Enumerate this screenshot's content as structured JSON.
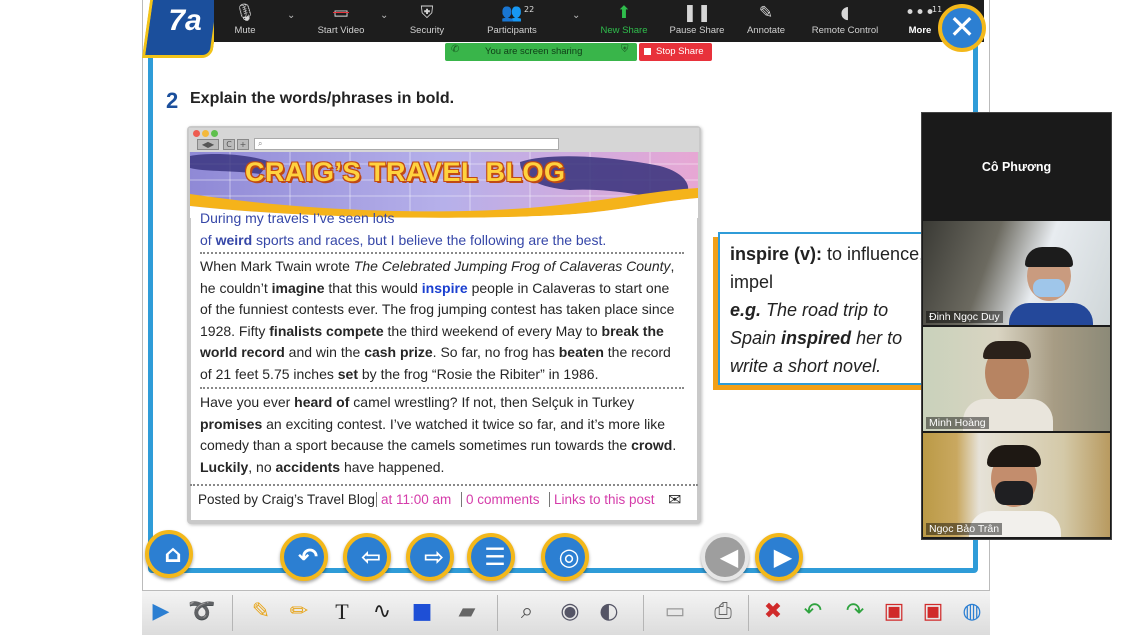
{
  "zoom": {
    "toolbar": [
      {
        "label": "Mute",
        "icon": "microphone-icon"
      },
      {
        "label": "Start Video",
        "icon": "video-off-icon"
      },
      {
        "label": "Security",
        "icon": "shield-icon"
      },
      {
        "label": "Participants",
        "icon": "participants-icon",
        "count": "22"
      },
      {
        "label": "New Share",
        "icon": "share-arrow-icon"
      },
      {
        "label": "Pause Share",
        "icon": "pause-icon"
      },
      {
        "label": "Annotate",
        "icon": "pencil-icon"
      },
      {
        "label": "Remote Control",
        "icon": "mouse-icon"
      },
      {
        "label": "More",
        "icon": "more-dots-icon",
        "count": "11"
      }
    ],
    "sharing_banner": "You are screen sharing",
    "stop_share": "Stop Share",
    "host_name": "Cô Phương",
    "participants": [
      {
        "name": "Đinh Ngọc Duy"
      },
      {
        "name": "Minh Hoàng"
      },
      {
        "name": "Ngọc Bảo Trân"
      }
    ]
  },
  "slide": {
    "unit": "7a",
    "question_number": "2",
    "question": "Explain the words/phrases in bold.",
    "blog": {
      "title": "CRAIG’S TRAVEL BLOG",
      "p1_line1": "During my travels I’ve seen lots",
      "p1_line2_pre": "of ",
      "p1_line2_bold": "weird",
      "p1_line2_post": " sports and races, but I believe the following are the best.",
      "p2": [
        [
          "When Mark Twain wrote ",
          "i:The Celebrated Jumping Frog of Calaveras County",
          ","
        ],
        [
          "he couldn’t ",
          "b:imagine",
          " that this would ",
          "c:inspire",
          " people in Calaveras to start one"
        ],
        [
          "of the funniest contests ever. The frog jumping contest has taken place since"
        ],
        [
          "1928. Fifty ",
          "b:finalists compete",
          " the third weekend of every May to ",
          "b:break the"
        ],
        [
          "b:world record",
          " and win the ",
          "b:cash prize",
          ". So far, no frog has ",
          "b:beaten",
          " the record"
        ],
        [
          "of 21 feet 5.75 inches ",
          "b:set",
          " by the frog “Rosie the Ribiter” in 1986."
        ]
      ],
      "p3": [
        [
          "Have you ever ",
          "b:heard of",
          " camel wrestling? If not, then Selçuk in Turkey"
        ],
        [
          "b:promises",
          " an exciting contest. I’ve watched it twice so far, and it’s more like"
        ],
        [
          "comedy than a sport because the camels sometimes run towards the ",
          "b:crowd",
          "."
        ],
        [
          "b:Luckily",
          ", no ",
          "b:accidents",
          " have happened."
        ]
      ],
      "posted_by": "Posted by Craig’s Travel Blog",
      "time": "at 11:00 am",
      "comments": "0 comments",
      "links": "Links to this post"
    },
    "definition": {
      "term": "inspire (v):",
      "meaning": " to influence, impel",
      "eg_label": "e.g.",
      "eg_pre": " The road trip to Spain ",
      "eg_bold": "inspired",
      "eg_post": " her to write a short novel."
    }
  },
  "colors": {
    "zoom_bg": "#1d1d1d",
    "share_green": "#39b54a",
    "stop_red": "#e8323b",
    "frame_blue": "#2f9cd8",
    "nav_gold": "#f3b81b"
  }
}
